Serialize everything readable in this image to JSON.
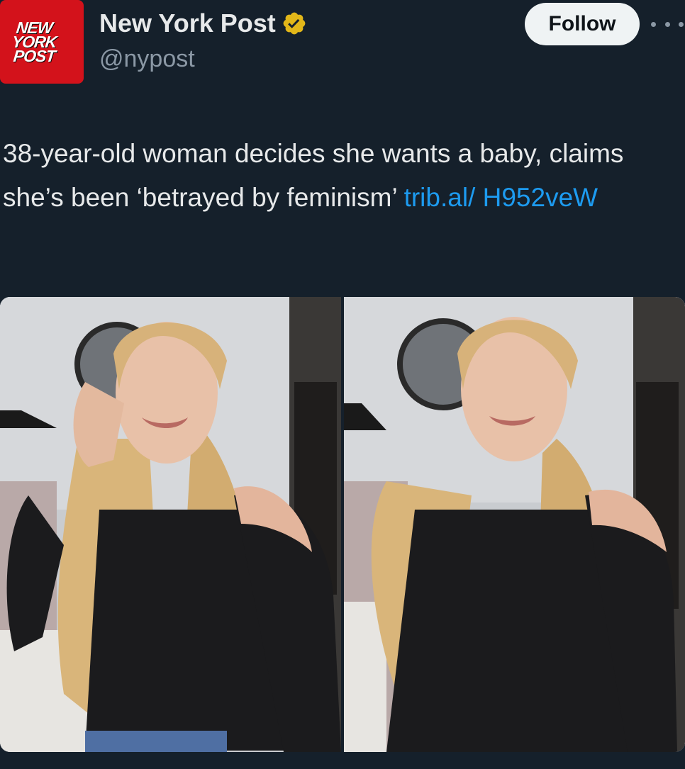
{
  "author": {
    "logo_lines": [
      "NEW",
      "YORK",
      "POST"
    ],
    "display_name": "New York Post",
    "handle": "@nypost",
    "verified_badge": "gold-verified-icon"
  },
  "actions": {
    "follow_label": "Follow",
    "more_icon": "more-icon"
  },
  "tweet": {
    "text": "38-year-old woman decides she wants a baby, claims she’s been ‘betrayed by feminism’ ",
    "link": "trib.al/ H952veW"
  },
  "media": {
    "count": 2,
    "description_icon": "photo"
  },
  "colors": {
    "background": "#15202b",
    "link": "#1d9bf0",
    "logo_red": "#d3121b",
    "badge_gold": "#e2b719"
  }
}
